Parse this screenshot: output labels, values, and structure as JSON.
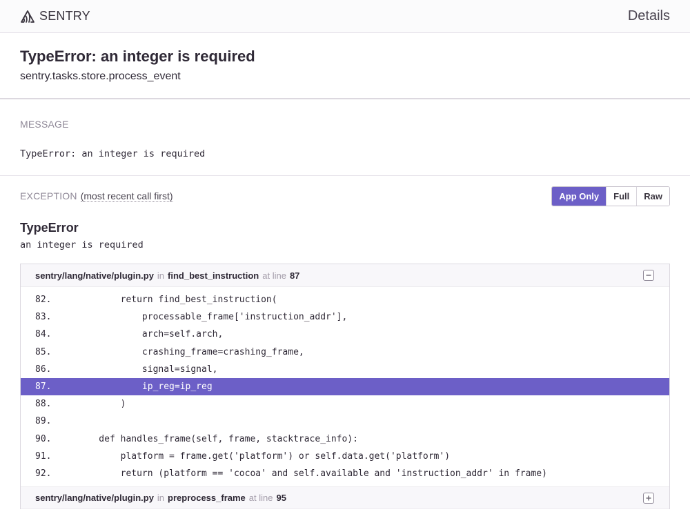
{
  "topbar": {
    "brand": "SENTRY",
    "page_heading": "Details"
  },
  "header": {
    "title": "TypeError: an integer is required",
    "culprit": "sentry.tasks.store.process_event"
  },
  "message": {
    "label": "MESSAGE",
    "text": "TypeError: an integer is required"
  },
  "exception": {
    "label": "EXCEPTION",
    "subtitle": "(most recent call first)",
    "view_buttons": [
      {
        "label": "App Only",
        "active": true
      },
      {
        "label": "Full",
        "active": false
      },
      {
        "label": "Raw",
        "active": false
      }
    ],
    "type": "TypeError",
    "value": "an integer is required",
    "frames": [
      {
        "filename": "sentry/lang/native/plugin.py",
        "in_label": "in",
        "function": "find_best_instruction",
        "at_line_label": "at line",
        "line": "87",
        "expanded": true,
        "toggle_icon": "minus",
        "context": [
          {
            "no": "82.",
            "code": "        return find_best_instruction(",
            "active": false
          },
          {
            "no": "83.",
            "code": "            processable_frame['instruction_addr'],",
            "active": false
          },
          {
            "no": "84.",
            "code": "            arch=self.arch,",
            "active": false
          },
          {
            "no": "85.",
            "code": "            crashing_frame=crashing_frame,",
            "active": false
          },
          {
            "no": "86.",
            "code": "            signal=signal,",
            "active": false
          },
          {
            "no": "87.",
            "code": "            ip_reg=ip_reg",
            "active": true
          },
          {
            "no": "88.",
            "code": "        )",
            "active": false
          },
          {
            "no": "89.",
            "code": "",
            "active": false
          },
          {
            "no": "90.",
            "code": "    def handles_frame(self, frame, stacktrace_info):",
            "active": false
          },
          {
            "no": "91.",
            "code": "        platform = frame.get('platform') or self.data.get('platform')",
            "active": false
          },
          {
            "no": "92.",
            "code": "        return (platform == 'cocoa' and self.available and 'instruction_addr' in frame)",
            "active": false
          }
        ]
      },
      {
        "filename": "sentry/lang/native/plugin.py",
        "in_label": "in",
        "function": "preprocess_frame",
        "at_line_label": "at line",
        "line": "95",
        "expanded": false,
        "toggle_icon": "plus"
      }
    ]
  },
  "colors": {
    "accent": "#6c5fc7",
    "text": "#2f2936",
    "muted": "#8f8897"
  }
}
